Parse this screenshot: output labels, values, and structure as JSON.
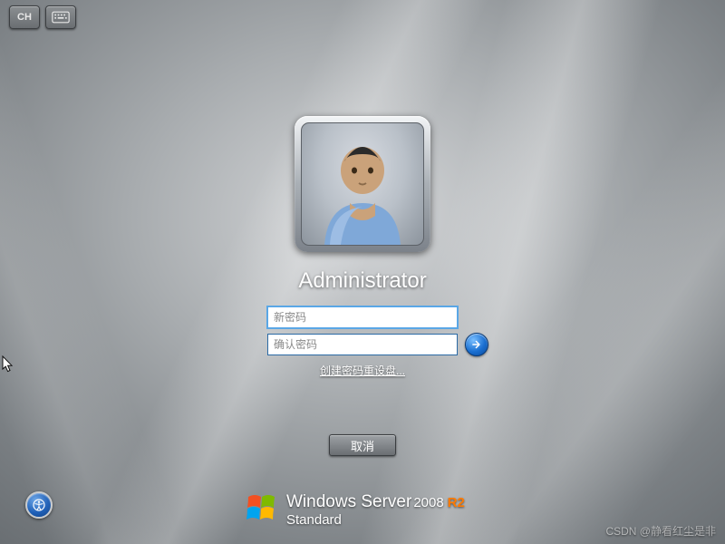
{
  "ime": {
    "lang_label": "CH",
    "icons": {
      "keyboard": "keyboard-icon"
    }
  },
  "login": {
    "username": "Administrator",
    "new_password_placeholder": "新密码",
    "confirm_password_placeholder": "确认密码",
    "new_password_value": "",
    "confirm_password_value": "",
    "reset_link_label": "创建密码重设盘...",
    "cancel_label": "取消",
    "avatar_icon": "generic-user-icon",
    "submit_icon": "arrow-right-icon"
  },
  "branding": {
    "product": "Windows Server",
    "year": "2008",
    "suffix": "R2",
    "edition": "Standard",
    "flag_icon": "windows-flag-icon"
  },
  "ease_of_access": {
    "icon": "ease-of-access-icon"
  },
  "watermark": "CSDN @静看红尘是非",
  "colors": {
    "accent_blue": "#1a6fd1",
    "suffix_orange": "#ff7a00"
  }
}
